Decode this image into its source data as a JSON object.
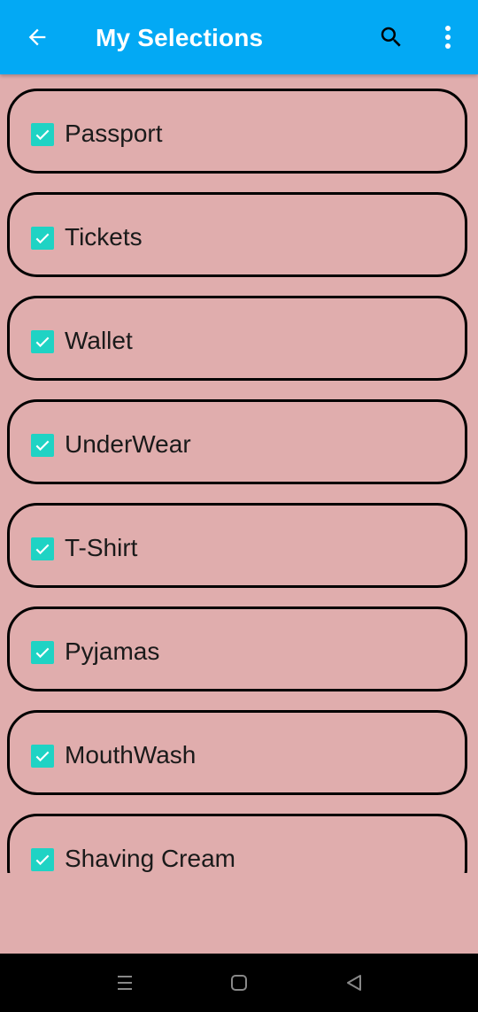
{
  "app_bar": {
    "title": "My Selections",
    "background_color": "#03a9f4",
    "icons": {
      "back": "arrow-back-icon",
      "search": "search-icon",
      "more": "more-vertical-icon"
    }
  },
  "list": {
    "checkbox_color": "#1fd3c4",
    "items": [
      {
        "label": "Passport",
        "checked": true
      },
      {
        "label": "Tickets",
        "checked": true
      },
      {
        "label": "Wallet",
        "checked": true
      },
      {
        "label": "UnderWear",
        "checked": true
      },
      {
        "label": "T-Shirt",
        "checked": true
      },
      {
        "label": "Pyjamas",
        "checked": true
      },
      {
        "label": "MouthWash",
        "checked": true
      },
      {
        "label": "Shaving Cream",
        "checked": true
      }
    ]
  },
  "nav_bar": {
    "icons": [
      "recent-apps-icon",
      "home-icon",
      "back-triangle-icon"
    ]
  }
}
